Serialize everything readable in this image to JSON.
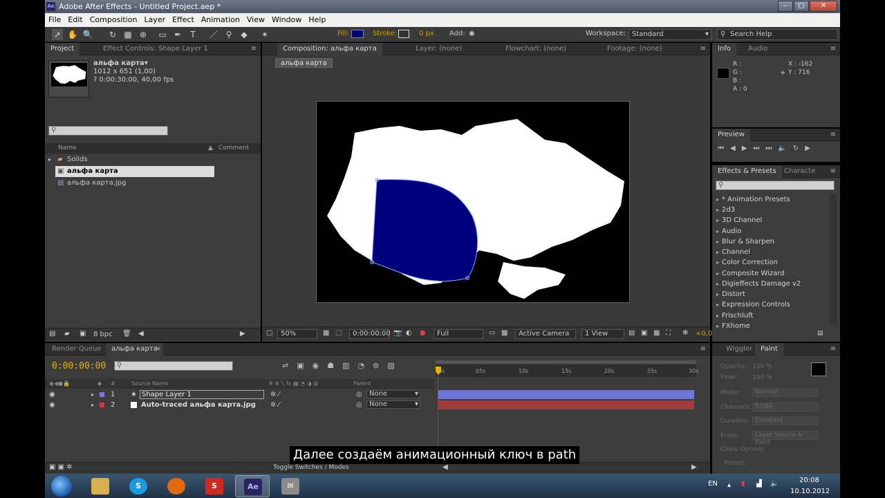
{
  "window": {
    "title": "Adobe After Effects - Untitled Project.aep *",
    "app_icon": "Ae",
    "btn_min": "–",
    "btn_max": "▢",
    "btn_close": "✕"
  },
  "menu": [
    "File",
    "Edit",
    "Composition",
    "Layer",
    "Effect",
    "Animation",
    "View",
    "Window",
    "Help"
  ],
  "toolbar": {
    "fill_label": "Fill:",
    "stroke_label": "Stroke:",
    "stroke_width": "0 px",
    "add_label": "Add:",
    "workspace_label": "Workspace:",
    "workspace_value": "Standard",
    "search_help": "Search Help"
  },
  "project": {
    "tabs": [
      "Project",
      "Effect Controls: Shape Layer 1"
    ],
    "thumb_name": "альфа карта▾",
    "thumb_size": "1012 x 651 (1,00)",
    "thumb_duration": "? 0:00:30:00, 40,00 fps",
    "col_name": "Name",
    "col_comment": "Comment",
    "items": [
      {
        "label": "Solids"
      },
      {
        "label": "альфа карта"
      },
      {
        "label": "альфа карта.jpg"
      }
    ],
    "bpc": "8 bpc"
  },
  "comp": {
    "tabs": [
      "Composition: альфа карта",
      "Layer: (none)",
      "Flowchart: (none)",
      "Footage: (none)"
    ],
    "tag": "альфа карта",
    "zoom": "50%",
    "timecode": "0:00:00:00",
    "resolution": "Full",
    "camera": "Active Camera",
    "view": "1 View",
    "exposure": "+0,0"
  },
  "info": {
    "tabs": [
      "Info",
      "Audio"
    ],
    "r": "R :",
    "g": "G :",
    "b": "B :",
    "a": "A : 0",
    "x": "X : -162",
    "y": "Y : 716"
  },
  "preview": {
    "tab": "Preview"
  },
  "effects": {
    "tabs": [
      "Effects & Presets",
      "Characte"
    ],
    "items": [
      "* Animation Presets",
      "2d3",
      "3D Channel",
      "Audio",
      "Blur & Sharpen",
      "Channel",
      "Color Correction",
      "Composite Wizard",
      "Digieffects Damage v2",
      "Distort",
      "Expression Controls",
      "Frischluft",
      "FXhome"
    ]
  },
  "paint": {
    "tabs": [
      "Wiggler",
      "Paint"
    ],
    "opacity_label": "Opacity:",
    "opacity_value": "100 %",
    "flow_label": "Flow:",
    "flow_value": "100 %",
    "mode_label": "Mode:",
    "mode_value": "Normal",
    "channels_label": "Channels:",
    "channels_value": "RGBA",
    "duration_label": "Duration:",
    "duration_value": "Constant",
    "erase_label": "Erase:",
    "erase_value": "Layer Source & Paint",
    "clone_options": "Clone Options",
    "preset_label": "Preset:"
  },
  "timeline": {
    "tabs": [
      "Render Queue",
      "альфа карта"
    ],
    "timecode": "0:00:00:00",
    "header_num": "#",
    "header_source": "Source Name",
    "header_parent": "Parent",
    "layers": [
      {
        "num": "1",
        "name": "Shape Layer 1",
        "parent": "None",
        "color": "#7a7ae0"
      },
      {
        "num": "2",
        "name": "Auto-traced альфа карта.jpg",
        "parent": "None",
        "color": "#c04040"
      }
    ],
    "ruler_ticks": [
      "0s",
      "05s",
      "10s",
      "15s",
      "20s",
      "25s",
      "30s"
    ],
    "toggle_label": "Toggle Switches / Modes"
  },
  "subtitle": "Далее создаём анимационный ключ в path",
  "taskbar": {
    "lang": "EN",
    "time": "20:08",
    "date": "10.10.2012",
    "ae_label": "Ae",
    "apps": [
      "explorer",
      "skype",
      "firefox",
      "slides",
      "after-effects",
      "mail"
    ]
  },
  "colors": {
    "shape_fill": "#00007f",
    "timecode": "#e5b000",
    "layer1_bar": "#6e77d6",
    "layer2_bar": "#a33b3b"
  }
}
